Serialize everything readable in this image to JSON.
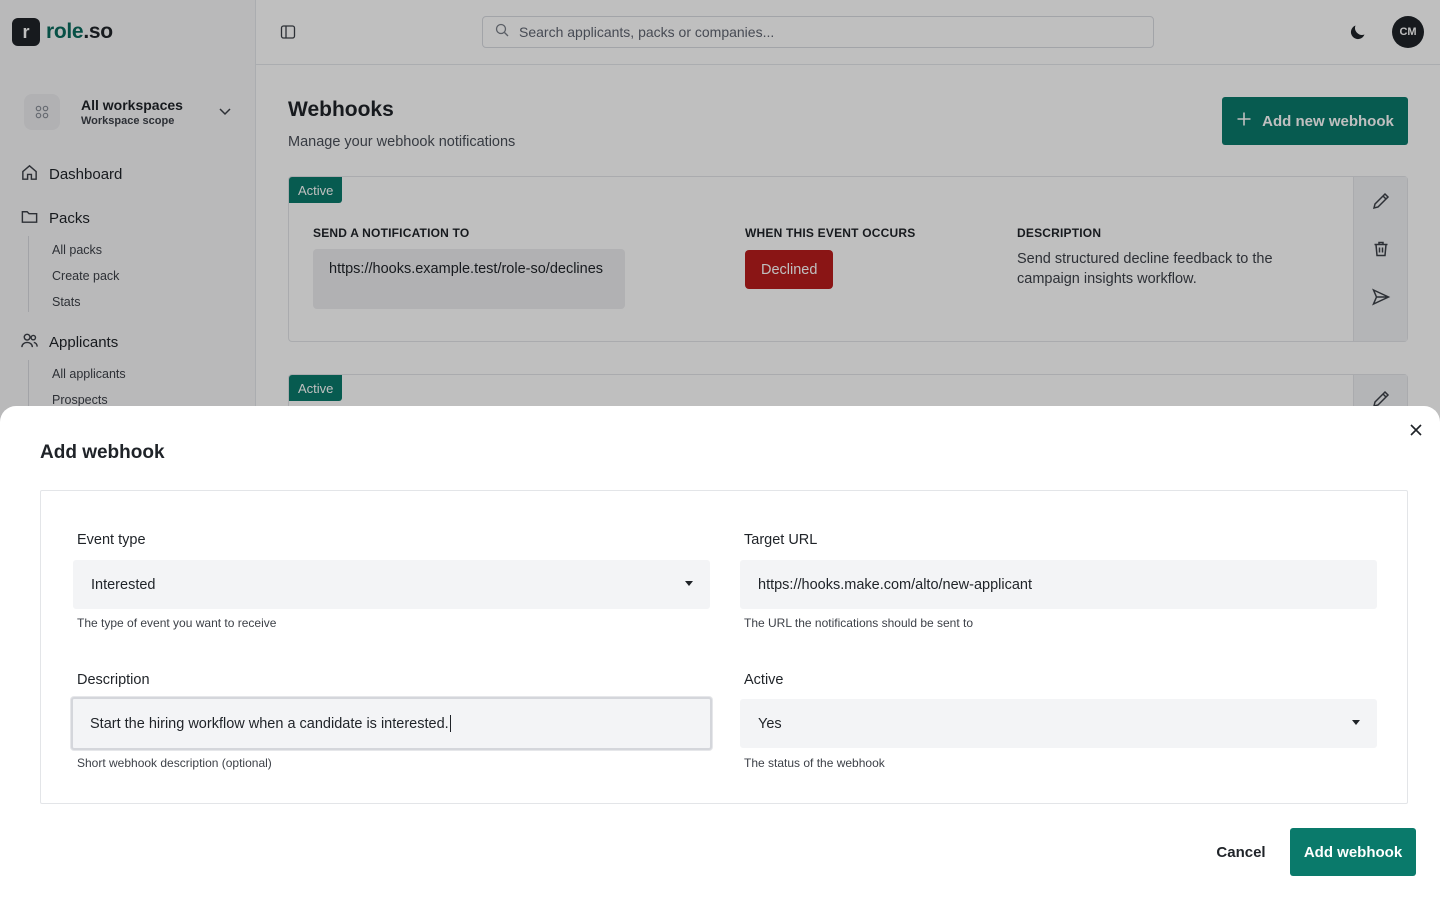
{
  "brand": {
    "logo_letter": "r",
    "name": "role",
    "tld": ".so",
    "color": "#0a7a6b"
  },
  "sidebar": {
    "workspace": {
      "title": "All workspaces",
      "subtitle": "Workspace scope"
    },
    "nav": [
      {
        "label": "Dashboard",
        "icon": "home-icon"
      },
      {
        "label": "Packs",
        "icon": "folder-icon",
        "children": [
          "All packs",
          "Create pack",
          "Stats"
        ]
      },
      {
        "label": "Applicants",
        "icon": "users-icon",
        "children": [
          "All applicants",
          "Prospects"
        ]
      }
    ]
  },
  "topbar": {
    "search_placeholder": "Search applicants, packs or companies...",
    "avatar_initials": "CM"
  },
  "page": {
    "title": "Webhooks",
    "subtitle": "Manage your webhook notifications",
    "add_button": "Add new webhook"
  },
  "webhooks": [
    {
      "status": "Active",
      "col_target": "SEND A NOTIFICATION TO",
      "col_event": "WHEN THIS EVENT OCCURS",
      "col_desc": "DESCRIPTION",
      "url": "https://hooks.example.test/role-so/declines",
      "event": "Declined",
      "description": "Send structured decline feedback to the campaign insights workflow."
    },
    {
      "status": "Active"
    }
  ],
  "modal": {
    "title": "Add webhook",
    "fields": {
      "event_type": {
        "label": "Event type",
        "value": "Interested",
        "help": "The type of event you want to receive"
      },
      "target_url": {
        "label": "Target URL",
        "value": "https://hooks.make.com/alto/new-applicant",
        "help": "The URL the notifications should be sent to"
      },
      "description": {
        "label": "Description",
        "value": "Start the hiring workflow when a candidate is interested.",
        "help": "Short webhook description (optional)"
      },
      "active": {
        "label": "Active",
        "value": "Yes",
        "help": "The status of the webhook"
      }
    },
    "cancel_label": "Cancel",
    "submit_label": "Add webhook"
  }
}
